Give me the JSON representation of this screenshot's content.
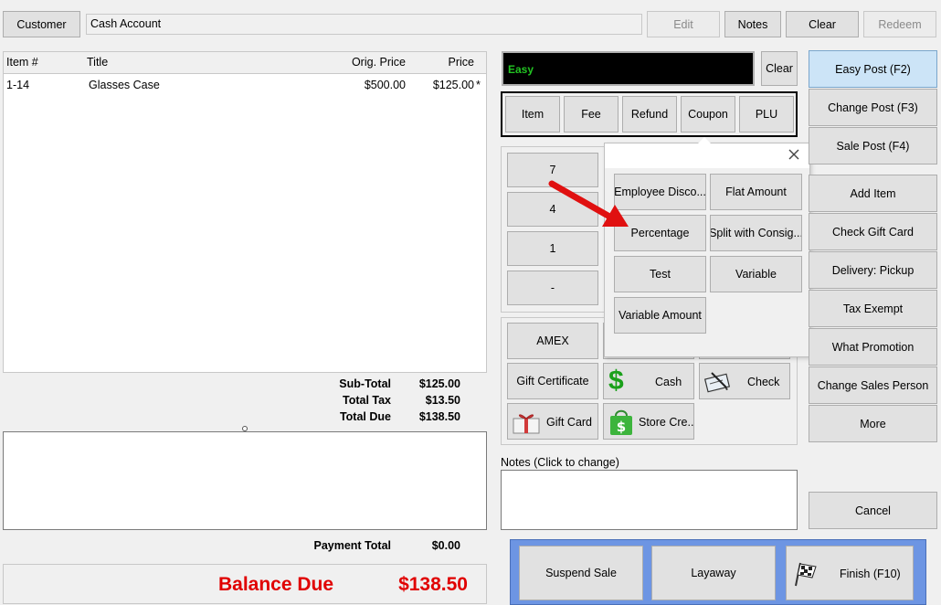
{
  "top": {
    "customer_button": "Customer",
    "customer_value": "Cash Account",
    "edit": "Edit",
    "notes": "Notes",
    "clear": "Clear",
    "redeem": "Redeem"
  },
  "items_table": {
    "headers": [
      "Item #",
      "Title",
      "Orig. Price",
      "Price"
    ],
    "rows": [
      {
        "item": "1-14",
        "title": "Glasses Case",
        "orig_price": "$500.00",
        "price": "$125.00",
        "flag": "*"
      }
    ]
  },
  "totals": {
    "subtotal_label": "Sub-Total",
    "subtotal": "$125.00",
    "tax_label": "Total Tax",
    "tax": "$13.50",
    "due_label": "Total Due",
    "due": "$138.50",
    "payment_label": "Payment Total",
    "payment": "$0.00",
    "balance_label": "Balance Due",
    "balance": "$138.50"
  },
  "entry": {
    "mode_text": "Easy",
    "clear": "Clear",
    "type_buttons": [
      "Item",
      "Fee",
      "Refund",
      "Coupon",
      "PLU"
    ]
  },
  "keypad": [
    "7",
    "4",
    "1",
    "-"
  ],
  "popup": {
    "options": [
      "Employee Disco...",
      "Flat Amount",
      "Percentage",
      "Split with Consig...",
      "Test",
      "Variable",
      "Variable Amount"
    ]
  },
  "tenders": {
    "amex": "AMEX",
    "gift_certificate": "Gift Certificate",
    "cash": "Cash",
    "check": "Check",
    "gift_card": "Gift Card",
    "store_credit": "Store Cre..."
  },
  "notes_label": "Notes (Click to change)",
  "right_buttons": {
    "easy_post": "Easy Post (F2)",
    "change_post": "Change Post (F3)",
    "sale_post": "Sale Post (F4)",
    "add_item": "Add Item",
    "check_gift_card": "Check Gift Card",
    "delivery": "Delivery: Pickup",
    "tax_exempt": "Tax Exempt",
    "what_promotion": "What Promotion",
    "change_sales_person": "Change Sales Person",
    "more": "More",
    "cancel": "Cancel"
  },
  "bottom": {
    "suspend": "Suspend Sale",
    "layaway": "Layaway",
    "finish": "Finish (F10)"
  },
  "colors": {
    "balance_red": "#e00000",
    "easy_green": "#22c322",
    "bottom_bar_blue": "#6d95e3",
    "selected_blue": "#cce4f7",
    "arrow_red": "#e01010"
  }
}
